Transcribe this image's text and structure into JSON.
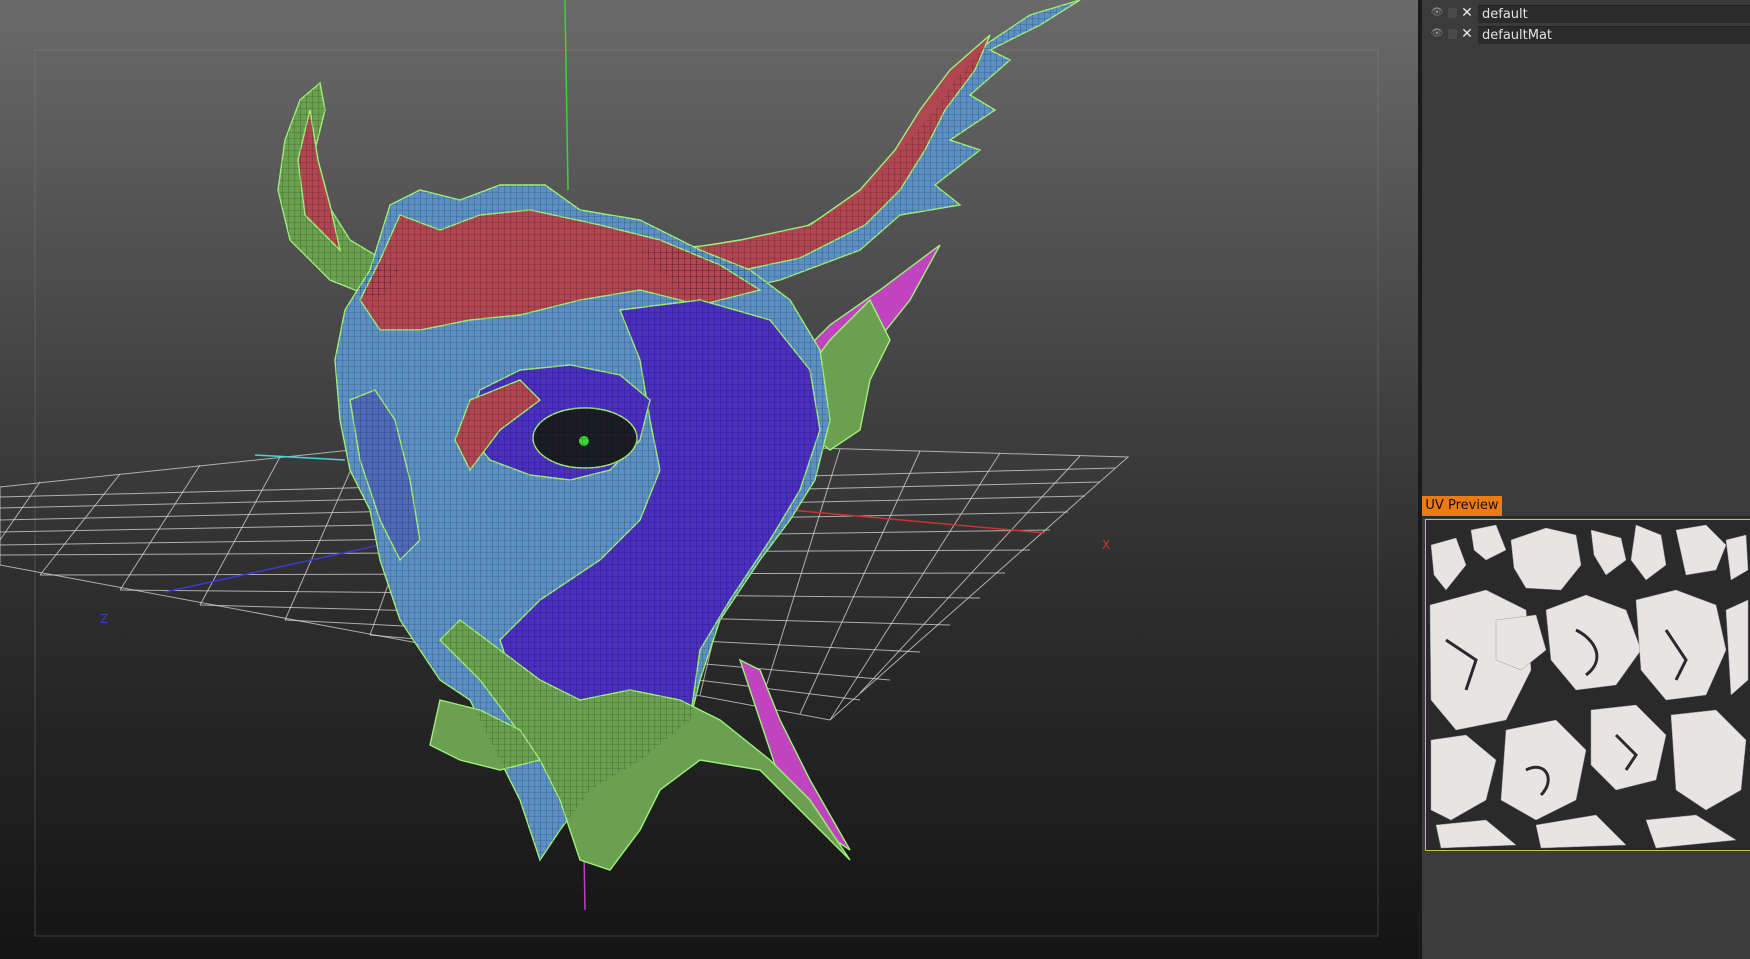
{
  "viewport": {
    "axis_labels": {
      "x": "X",
      "z": "Z"
    },
    "axis_colors": {
      "x": "#d33030",
      "y": "#39d439",
      "z": "#3a3ad8",
      "pivot": "#c23cc8"
    }
  },
  "materials_panel": {
    "items": [
      {
        "name": "default",
        "visible": true
      },
      {
        "name": "defaultMat",
        "visible": true
      }
    ]
  },
  "uv_preview": {
    "tab_label": "UV Preview",
    "tab_color": "#f07a10",
    "frame_color": "#c7c24a"
  },
  "mesh_colors": {
    "red": "#b04652",
    "blue": "#5c8fc4",
    "violet": "#4b2fc0",
    "green": "#6aa050",
    "magenta": "#c044c0"
  }
}
